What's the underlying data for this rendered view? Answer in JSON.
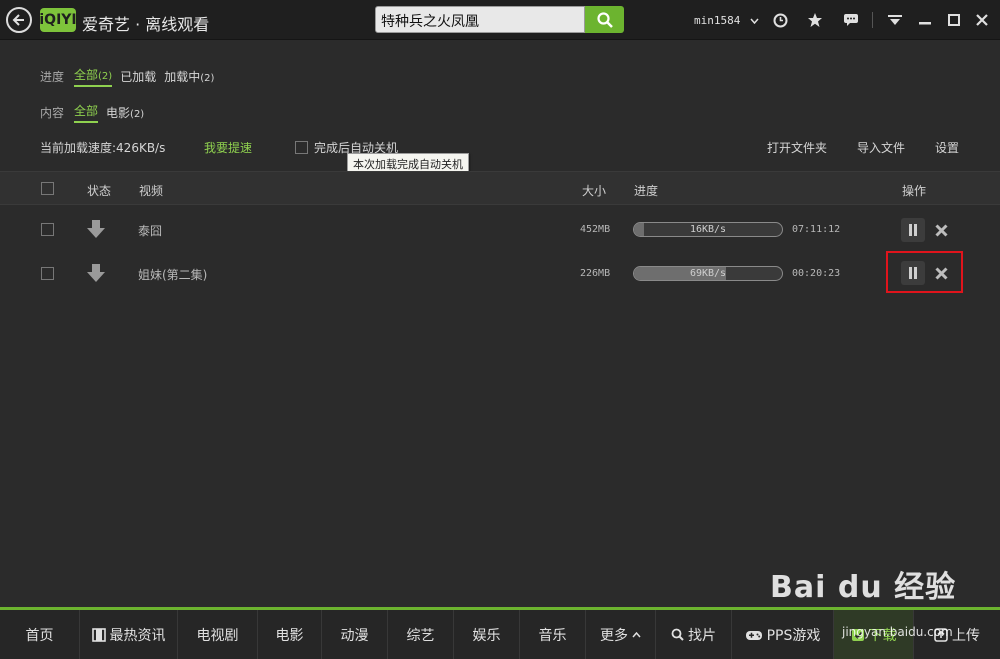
{
  "app": {
    "title": "爱奇艺 · 离线观看",
    "logo_text": "iQIYI",
    "accent": "#6cb42f"
  },
  "search": {
    "value": "特种兵之火凤凰"
  },
  "user": {
    "name": "min1584"
  },
  "icons": [
    "back-icon",
    "search-icon",
    "chevron-down-icon",
    "clock-icon",
    "star-icon",
    "message-icon",
    "menu-icon",
    "minimize-icon",
    "maximize-icon",
    "close-icon"
  ],
  "filters": {
    "progress": {
      "label": "进度",
      "items": [
        {
          "label": "全部",
          "count": "(2)",
          "active": true
        },
        {
          "label": "已加载",
          "count": "",
          "active": false
        },
        {
          "label": "加载中",
          "count": "(2)",
          "active": false
        }
      ]
    },
    "content": {
      "label": "内容",
      "items": [
        {
          "label": "全部",
          "count": "",
          "active": true
        },
        {
          "label": "电影",
          "count": "(2)",
          "active": false
        }
      ]
    }
  },
  "toolbar": {
    "speed_label": "当前加载速度:426KB/s",
    "speed_up": "我要提速",
    "auto_shutdown": "完成后自动关机",
    "tooltip": "本次加载完成自动关机",
    "open_folder": "打开文件夹",
    "import_file": "导入文件",
    "settings": "设置"
  },
  "table": {
    "headers": {
      "status": "状态",
      "video": "视频",
      "size": "大小",
      "progress": "进度",
      "actions": "操作"
    },
    "rows": [
      {
        "name": "泰囧",
        "size": "452MB",
        "speed": "16KB/s",
        "progress": 0.07,
        "eta": "07:11:12"
      },
      {
        "name": "姐妹(第二集)",
        "size": "226MB",
        "speed": "69KB/s",
        "progress": 0.62,
        "eta": "00:20:23"
      }
    ]
  },
  "bottom_nav": [
    {
      "label": "首页",
      "icon": ""
    },
    {
      "label": "最热资讯",
      "icon": "film-icon"
    },
    {
      "label": "电视剧",
      "icon": ""
    },
    {
      "label": "电影",
      "icon": ""
    },
    {
      "label": "动漫",
      "icon": ""
    },
    {
      "label": "综艺",
      "icon": ""
    },
    {
      "label": "娱乐",
      "icon": ""
    },
    {
      "label": "音乐",
      "icon": ""
    },
    {
      "label": "更多",
      "icon": "chevron-up-icon"
    },
    {
      "label": "找片",
      "icon": "search-icon"
    },
    {
      "label": "PPS游戏",
      "icon": "gamepad-icon"
    },
    {
      "label": "下载",
      "icon": "download-icon"
    },
    {
      "label": "上传",
      "icon": "upload-icon"
    }
  ],
  "watermark": {
    "brand": "Bai du 经验",
    "url": "jingyan.baidu.com"
  }
}
